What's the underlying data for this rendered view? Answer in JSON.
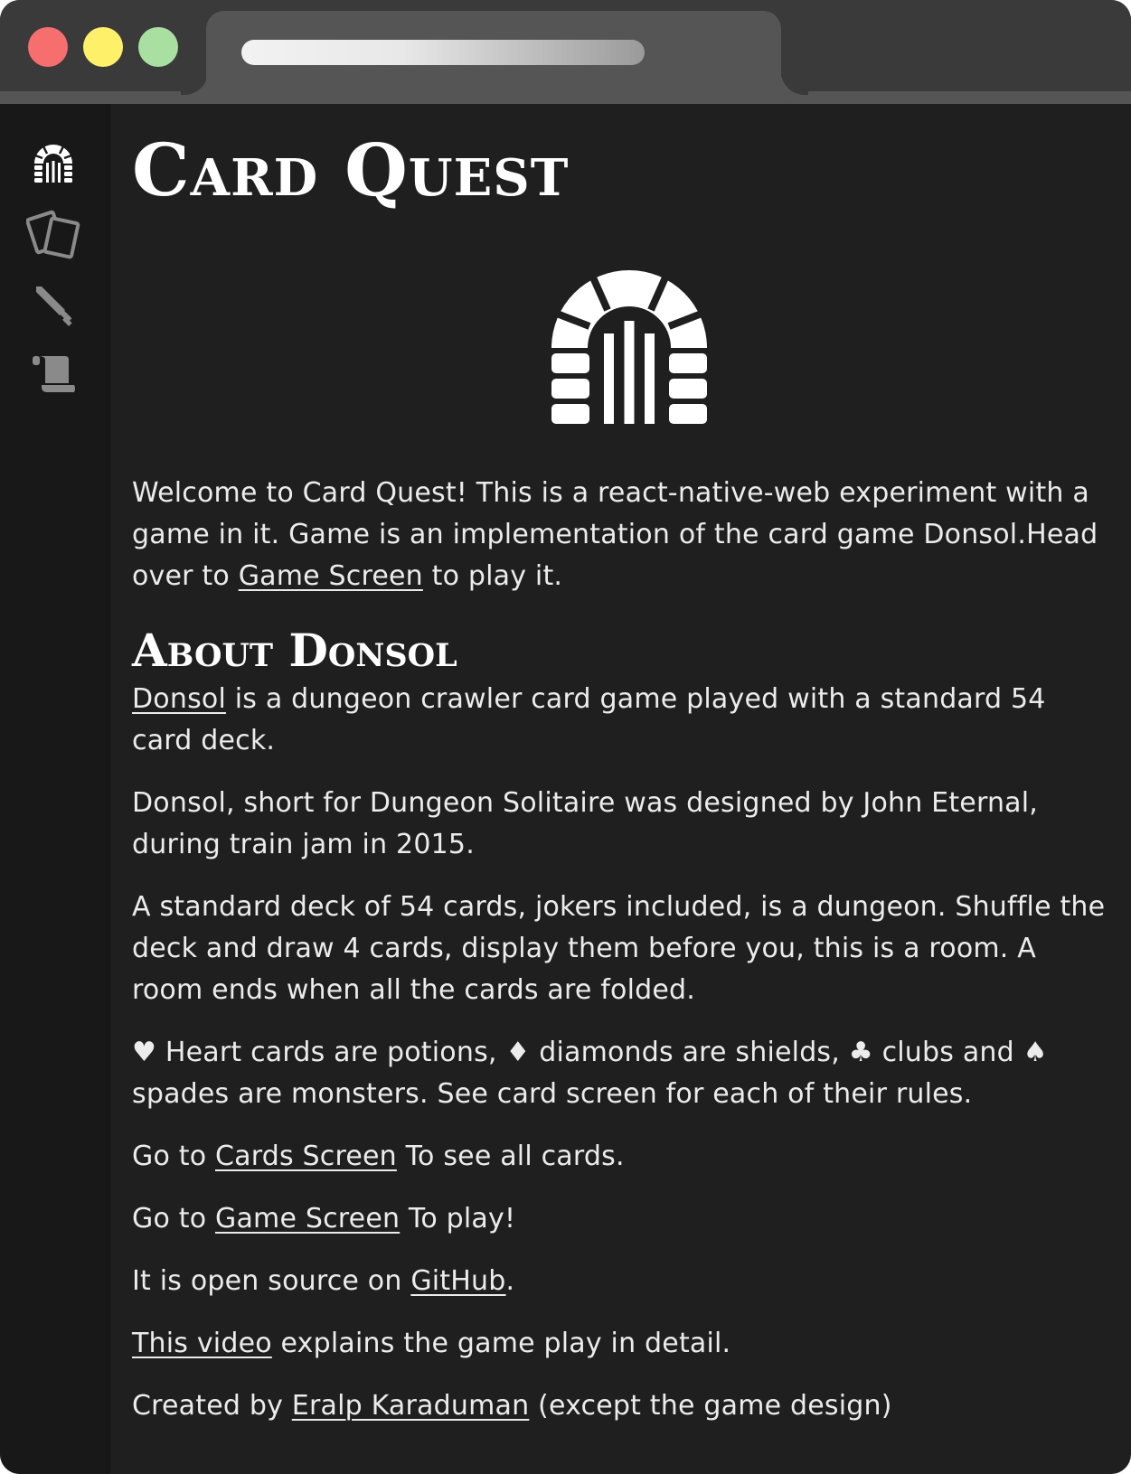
{
  "app": {
    "title": "Card Quest"
  },
  "sidebar": {
    "items": [
      {
        "icon": "dungeon-gate-icon"
      },
      {
        "icon": "cards-icon"
      },
      {
        "icon": "sword-icon"
      },
      {
        "icon": "scroll-icon"
      }
    ]
  },
  "intro": {
    "text_before": "Welcome to Card Quest! This is a react-native-web experiment with a game in it. Game is an implementation of the card game Donsol.Head over to ",
    "link": "Game Screen",
    "text_after": " to play it."
  },
  "about": {
    "title": "About Donsol",
    "p1_link": "Donsol",
    "p1_text": " is a dungeon crawler card game played with a standard 54 card deck.",
    "p2": "Donsol, short for Dungeon Solitaire was designed by John Eternal, during train jam in 2015.",
    "p3": "A standard deck of 54 cards, jokers included, is a dungeon. Shuffle the deck and draw 4 cards, display them before you, this is a room. A room ends when all the cards are folded.",
    "p4": "♥ Heart cards are potions, ♦ diamonds are shields, ♣ clubs and ♠ spades are monsters. See card screen for each of their rules.",
    "p5_before": "Go to ",
    "p5_link": "Cards Screen",
    "p5_after": " To see all cards.",
    "p6_before": "Go to ",
    "p6_link": "Game Screen",
    "p6_after": " To play!",
    "p7_before": "It is open source on ",
    "p7_link": "GitHub",
    "p7_after": ".",
    "p8_link": "This video",
    "p8_after": " explains the game play in detail.",
    "p9_before": "Created by ",
    "p9_link": "Eralp Karaduman",
    "p9_after": " (except the game design)"
  },
  "colors": {
    "background": "#1f1f1f",
    "sidebar": "#181818",
    "text": "#ececec",
    "titlebar": "#3a3a3a",
    "tab": "#555555"
  }
}
